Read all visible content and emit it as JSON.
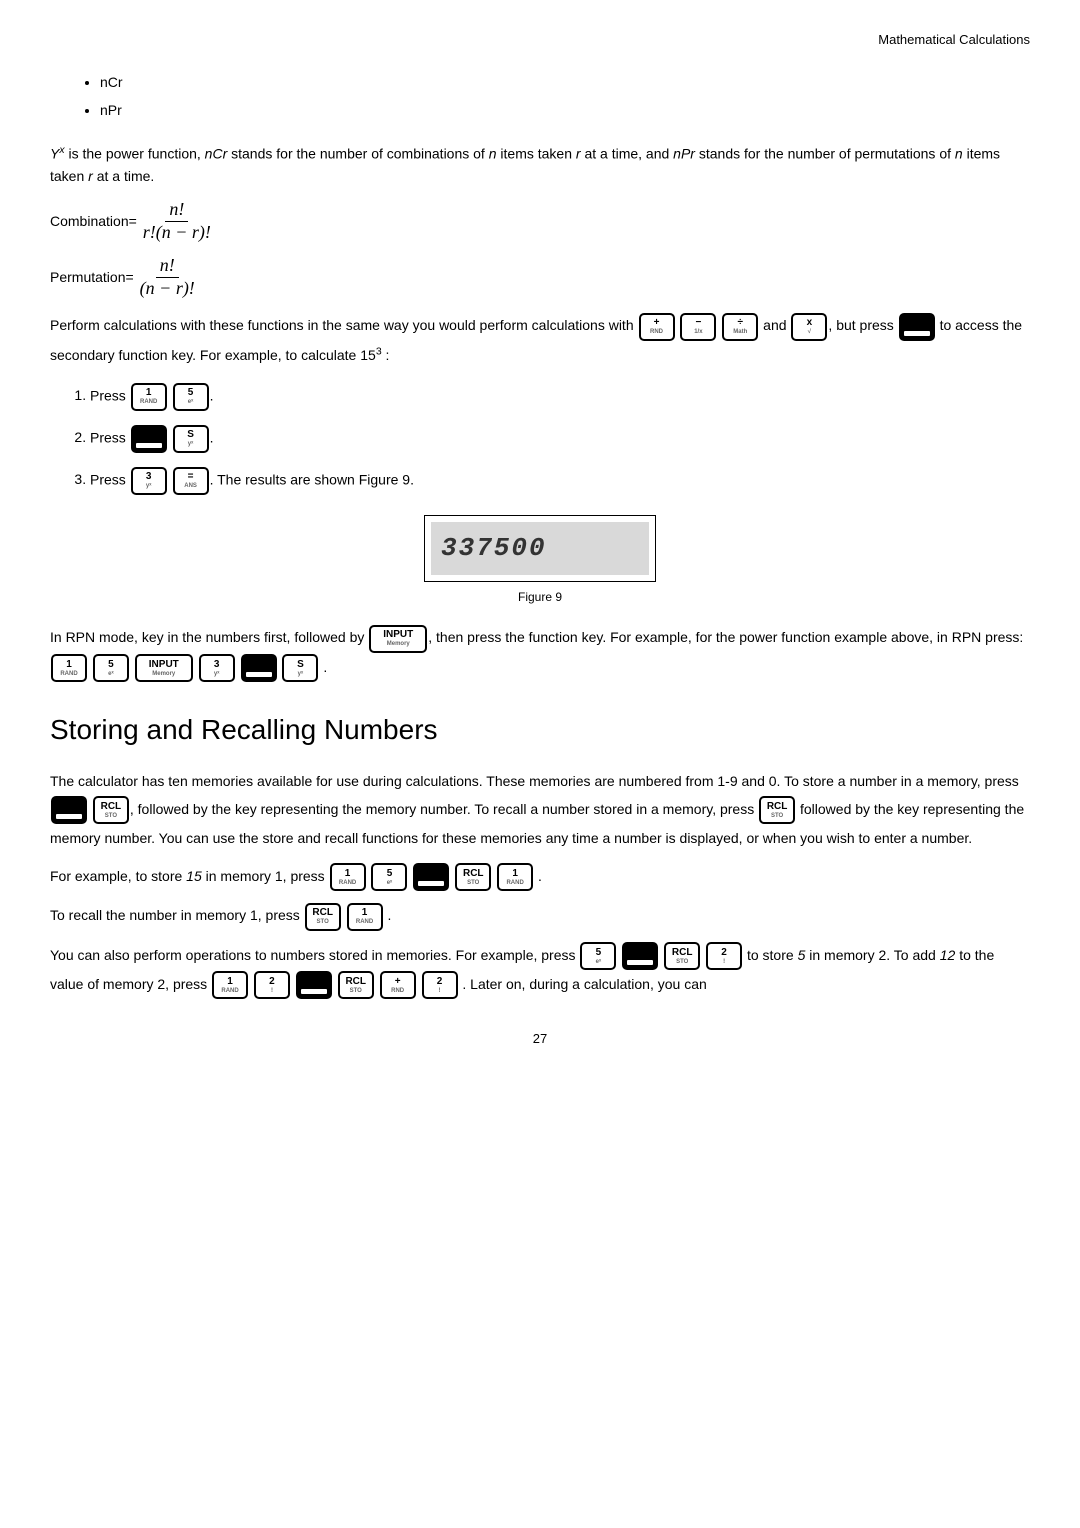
{
  "header": {
    "section": "Mathematical Calculations"
  },
  "bullets": [
    "nCr",
    "nPr"
  ],
  "intro": {
    "p1a": "Y",
    "p1b": " is the power function, ",
    "p1c": "nCr",
    "p1d": " stands for the number of combinations of ",
    "p1e": "n",
    "p1f": " items taken ",
    "p1g": "r",
    "p1h": " at a time, and ",
    "p1i": "nPr",
    "p1j": " stands for the number of permutations of ",
    "p1k": "n",
    "p1l": " items taken ",
    "p1m": "r",
    "p1n": " at a time."
  },
  "formulas": {
    "comb_label": "Combination=",
    "comb_num": "n!",
    "comb_den": "r!(n − r)!",
    "perm_label": "Permutation=",
    "perm_num": "n!",
    "perm_den": "(n − r)!"
  },
  "perform": {
    "a": "Perform calculations with these functions in the same way you would perform calculations with ",
    "b": " and ",
    "c": ", but press ",
    "d": " to access the secondary function key. For example, to calculate 15",
    "e": " :"
  },
  "steps": {
    "s1": "Press ",
    "s2": "Press ",
    "s3a": "Press ",
    "s3b": ". The results are shown Figure 9."
  },
  "keys": {
    "plus_top": "+",
    "plus_bot": "RND",
    "minus_top": "−",
    "minus_bot": "1/x",
    "div_top": "÷",
    "div_bot": "Math",
    "mul_top": "x",
    "mul_bot": "√",
    "one_top": "1",
    "one_bot": "RAND",
    "two_top": "2",
    "two_bot": "!",
    "three_top": "3",
    "three_bot": "yˣ",
    "five_top": "5",
    "five_bot": "eˣ",
    "eq_top": "=",
    "eq_bot": "ANS",
    "s_top": "S",
    "s_bot": "yˣ",
    "input_top": "INPUT",
    "input_bot": "Memory",
    "rcl_top": "RCL",
    "rcl_bot": "STO",
    "rcl2_top": "RCL",
    "rcl2_bot": "STO"
  },
  "display": {
    "value": "337500",
    "caption": "Figure 9"
  },
  "rpn": {
    "a": "In RPN mode, key in the numbers first, followed by ",
    "b": ", then press the function key. For example, for the power function example above, in RPN press: ",
    "c": "."
  },
  "section2": {
    "title": "Storing and Recalling Numbers"
  },
  "mem": {
    "p1a": "The calculator has ten memories available for use during calculations. These memories are numbered from 1-9 and 0. To store a number in a memory, press ",
    "p1b": ", followed by the key representing the memory number. To recall a number stored in a memory, press ",
    "p1c": " followed by the key representing the memory number. You can use the store and recall functions for these memories any time a number is displayed, or when you wish to enter a number.",
    "p2a": "For example, to store ",
    "p2num": "15",
    "p2b": " in memory 1, press ",
    "p2c": ".",
    "p3a": "To recall the number in memory 1, press ",
    "p3b": ".",
    "p4a": "You can also perform operations to numbers stored in memories. For example, press ",
    "p4b": " to store ",
    "p4num1": "5",
    "p4c": " in memory 2. To add ",
    "p4num2": "12",
    "p4d": " to the value of memory 2, press ",
    "p4e": ". Later on, during a calculation, you can"
  },
  "page": "27",
  "exp": {
    "x": "x",
    "three": "3"
  }
}
